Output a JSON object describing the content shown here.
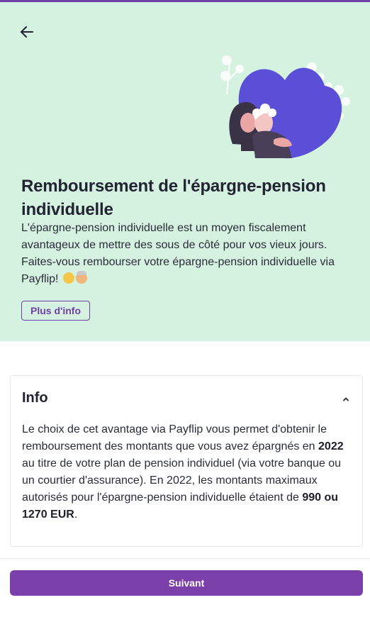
{
  "hero": {
    "title": "Remboursement de l'épargne-pension individuelle",
    "description": "L'épargne-pension individuelle est un moyen fiscalement avantageux de mettre des sous de côté pour vos vieux jours. Faites-vous rembourser votre épargne-pension individuelle via Payflip!",
    "more_info_label": "Plus d'info",
    "background_color": "#d5f2e1"
  },
  "info": {
    "title": "Info",
    "body": {
      "p1": "Le choix de cet avantage via Payflip vous permet d'obtenir le remboursement des montants que vous avez épargnés en ",
      "year": "2022",
      "p2": " au titre de votre plan de pension individuel (via votre banque ou un courtier d'assurance). En 2022, les montants maximaux autorisés pour l'épargne-pension individuelle étaient de ",
      "amounts": "990 ou 1270 EUR",
      "p3": "."
    }
  },
  "footer": {
    "next_label": "Suivant",
    "accent_color": "#7a3fa8"
  },
  "icons": {
    "back": "arrow-left-icon",
    "collapse": "chevron-up-icon",
    "emoji1": "older-man-emoji",
    "emoji2": "older-woman-emoji"
  }
}
